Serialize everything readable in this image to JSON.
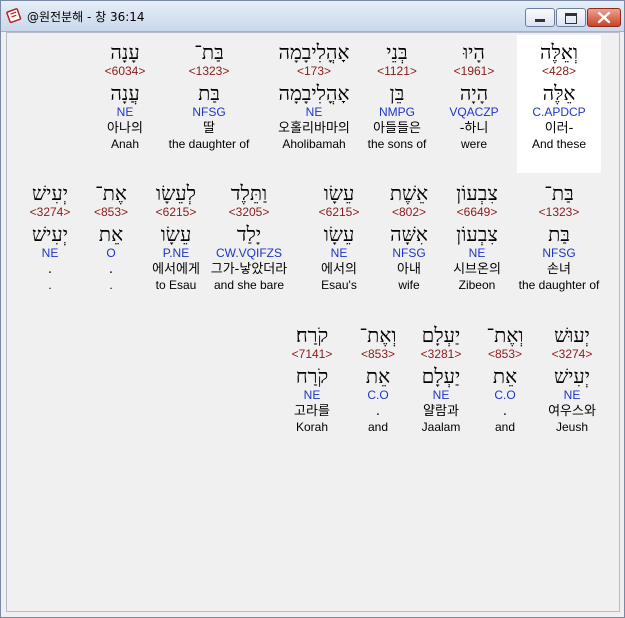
{
  "window": {
    "title": "@원전분해 - 창 36:14",
    "icon": "bible-book-icon"
  },
  "rows": [
    [
      {
        "heb": "עָנָה",
        "strong": "<6034>",
        "lemma": "עֲנָה",
        "parse": "NE",
        "kor": "아나의",
        "eng": "Anah"
      },
      {
        "heb": "בַּת־",
        "strong": "<1323>",
        "lemma": "בַּת",
        "parse": "NFSG",
        "kor": "딸",
        "eng": "the daughter of"
      },
      {
        "heb": "אָהֳלִיבָמָה",
        "strong": "<173>",
        "lemma": "אָהֳלִיבָמָה",
        "parse": "NE",
        "kor": "오홀리바마의",
        "eng": "Aholibamah"
      },
      {
        "heb": "בְּנֵי",
        "strong": "<1121>",
        "lemma": "בֵּן",
        "parse": "NMPG",
        "kor": "아들들은",
        "eng": "the sons of"
      },
      {
        "heb": "הָיוּ",
        "strong": "<1961>",
        "lemma": "הָיָה",
        "parse": "VQACZP",
        "kor": "-하니",
        "eng": "were"
      },
      {
        "heb": "וְאֵלֶּה",
        "strong": "<428>",
        "lemma": "אֵלֶּה",
        "parse": "C.APDCP",
        "kor": "이러-",
        "eng": "And these"
      }
    ],
    [
      {
        "heb": "יְעִישׁ",
        "strong": "<3274>",
        "lemma": "יְעִישׁ",
        "parse": "NE",
        "kor": ".",
        "eng": "."
      },
      {
        "heb": "אֶת־",
        "strong": "<853>",
        "lemma": "אֵת",
        "parse": "O",
        "kor": ".",
        "eng": "."
      },
      {
        "heb": "לְעֵשָׂו",
        "strong": "<6215>",
        "lemma": "עֵשָׂו",
        "parse": "P.NE",
        "kor": "에서에게",
        "eng": "to Esau"
      },
      {
        "heb": "וַתֵּלֶד",
        "strong": "<3205>",
        "lemma": "יָלַד",
        "parse": "CW.VQIFZS",
        "kor": "그가-낳았더라",
        "eng": "and she bare"
      },
      {
        "heb": "עֵשָׂו",
        "strong": "<6215>",
        "lemma": "עֵשָׂו",
        "parse": "NE",
        "kor": "에서의",
        "eng": "Esau's"
      },
      {
        "heb": "אֵשֶׁת",
        "strong": "<802>",
        "lemma": "אִשָּׁה",
        "parse": "NFSG",
        "kor": "아내",
        "eng": "wife"
      },
      {
        "heb": "צִבְעוֹן",
        "strong": "<6649>",
        "lemma": "צִבְעוֹן",
        "parse": "NE",
        "kor": "시브온의",
        "eng": "Zibeon"
      },
      {
        "heb": "בַּת־",
        "strong": "<1323>",
        "lemma": "בַּת",
        "parse": "NFSG",
        "kor": "손녀",
        "eng": "the daughter of"
      }
    ],
    [
      {
        "heb": "קֹרַח׃",
        "strong": "<7141>",
        "lemma": "קֹרַח",
        "parse": "NE",
        "kor": "고라를",
        "eng": "Korah"
      },
      {
        "heb": "וְאֶת־",
        "strong": "<853>",
        "lemma": "אֵת",
        "parse": "C.O",
        "kor": ".",
        "eng": "and"
      },
      {
        "heb": "יַעְלָם",
        "strong": "<3281>",
        "lemma": "יַעְלָם",
        "parse": "NE",
        "kor": "얄람과",
        "eng": "Jaalam"
      },
      {
        "heb": "וְאֶת־",
        "strong": "<853>",
        "lemma": "אֵת",
        "parse": "C.O",
        "kor": ".",
        "eng": "and"
      },
      {
        "heb": "יְעוּשׁ",
        "strong": "<3274>",
        "lemma": "יְעִישׁ",
        "parse": "NE",
        "kor": "여우스와",
        "eng": "Jeush"
      }
    ]
  ]
}
